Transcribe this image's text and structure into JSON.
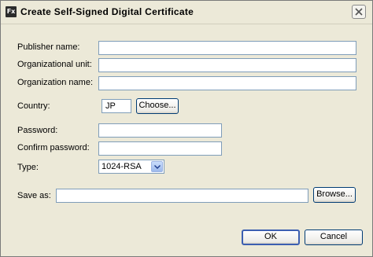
{
  "window": {
    "title": "Create Self-Signed Digital Certificate",
    "app_icon": "Fx"
  },
  "form": {
    "publisher_name": {
      "label": "Publisher name:",
      "value": ""
    },
    "organizational_unit": {
      "label": "Organizational unit:",
      "value": ""
    },
    "organization_name": {
      "label": "Organization name:",
      "value": ""
    },
    "country": {
      "label": "Country:",
      "value": "JP",
      "choose_label": "Choose..."
    },
    "password": {
      "label": "Password:",
      "value": ""
    },
    "confirm_password": {
      "label": "Confirm password:",
      "value": ""
    },
    "type": {
      "label": "Type:",
      "value": "1024-RSA"
    },
    "save_as": {
      "label": "Save as:",
      "value": "",
      "browse_label": "Browse..."
    }
  },
  "actions": {
    "ok_label": "OK",
    "cancel_label": "Cancel"
  },
  "icons": {
    "close": "close-icon",
    "dropdown": "chevron-down-icon"
  }
}
